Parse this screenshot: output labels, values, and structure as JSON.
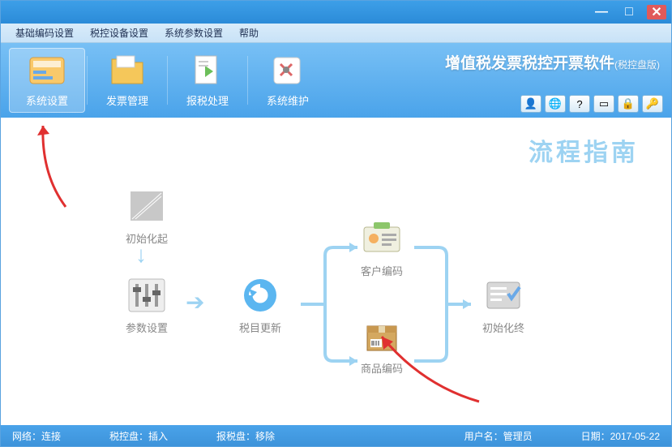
{
  "window": {
    "minimize": "—",
    "maximize": "□",
    "close": "✕"
  },
  "menubar": [
    "基础编码设置",
    "税控设备设置",
    "系统参数设置",
    "帮助"
  ],
  "toolbar": {
    "items": [
      {
        "label": "系统设置"
      },
      {
        "label": "发票管理"
      },
      {
        "label": "报税处理"
      },
      {
        "label": "系统维护"
      }
    ]
  },
  "brand": {
    "title": "增值税发票税控开票软件",
    "sub": "(税控盘版)"
  },
  "quickbar_icons": [
    "user-icon",
    "globe-icon",
    "help-icon",
    "window-icon",
    "lock-icon",
    "key-icon"
  ],
  "content": {
    "flow_title": "流程指南",
    "nodes": {
      "init_start": "初始化起",
      "param": "参数设置",
      "tax_update": "税目更新",
      "customer": "客户编码",
      "product": "商品编码",
      "init_end": "初始化终"
    }
  },
  "statusbar": {
    "network": "网络：连接",
    "taxdisk": "税控盘：插入",
    "reportdisk": "报税盘：移除",
    "user": "用户名：管理员",
    "date": "日期：2017-05-22"
  }
}
